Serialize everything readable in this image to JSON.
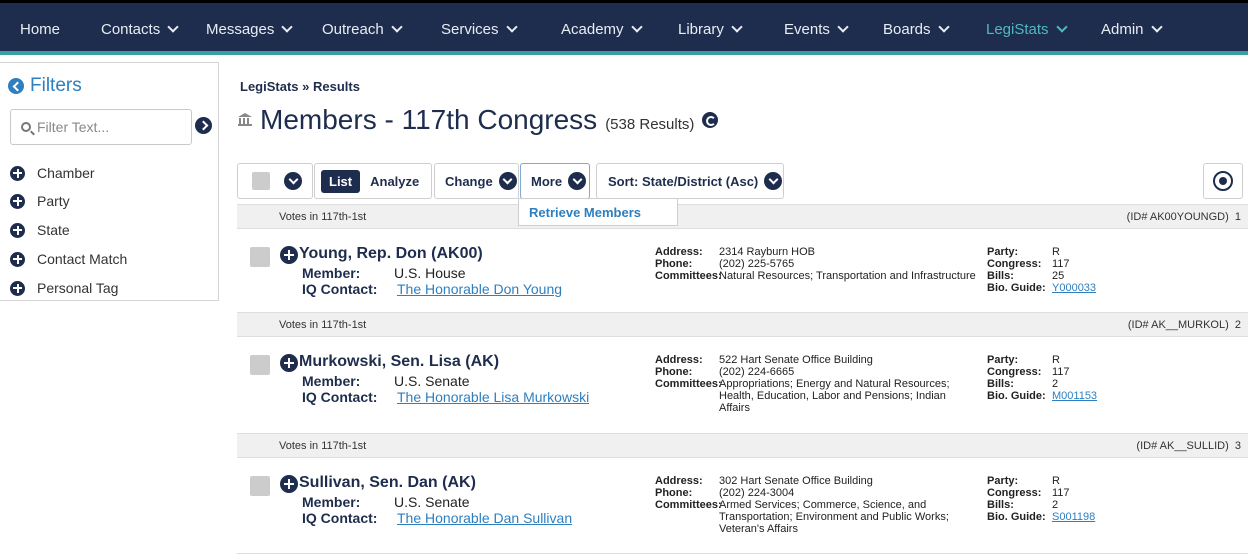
{
  "nav": {
    "items": [
      {
        "label": "Home",
        "dropdown": false
      },
      {
        "label": "Contacts",
        "dropdown": true
      },
      {
        "label": "Messages",
        "dropdown": true
      },
      {
        "label": "Outreach",
        "dropdown": true
      },
      {
        "label": "Services",
        "dropdown": true
      },
      {
        "label": "Academy",
        "dropdown": true
      },
      {
        "label": "Library",
        "dropdown": true
      },
      {
        "label": "Events",
        "dropdown": true
      },
      {
        "label": "Boards",
        "dropdown": true
      },
      {
        "label": "LegiStats",
        "dropdown": true,
        "active": true
      },
      {
        "label": "Admin",
        "dropdown": true
      }
    ]
  },
  "sidebar": {
    "title": "Filters",
    "filter_placeholder": "Filter Text...",
    "items": [
      "Chamber",
      "Party",
      "State",
      "Contact Match",
      "Personal Tag"
    ]
  },
  "breadcrumb": "LegiStats » Results",
  "page": {
    "title": "Members - 117th Congress",
    "count": "(538 Results)"
  },
  "toolbar": {
    "list": "List",
    "analyze": "Analyze",
    "change": "Change",
    "more": "More",
    "sort": "Sort: State/District (Asc)"
  },
  "dropdown": {
    "item": "Retrieve Members"
  },
  "records": [
    {
      "votes": "Votes in 117th-1st",
      "id": "(ID# AK00YOUNGD)",
      "index": "1",
      "name": "Young, Rep. Don (AK00)",
      "member_label": "Member:",
      "member": "U.S. House",
      "contact_label": "IQ Contact:",
      "contact": "The Honorable Don Young",
      "address_label": "Address:",
      "address": "2314 Rayburn HOB",
      "phone_label": "Phone:",
      "phone": "(202) 225-5765",
      "committees_label": "Committees:",
      "committees": "Natural Resources; Transportation and Infrastructure",
      "party_label": "Party:",
      "party": "R",
      "congress_label": "Congress:",
      "congress": "117",
      "bills_label": "Bills:",
      "bills": "25",
      "bio_label": "Bio. Guide:",
      "bio": "Y000033"
    },
    {
      "votes": "Votes in 117th-1st",
      "id": "(ID# AK__MURKOL)",
      "index": "2",
      "name": "Murkowski, Sen. Lisa (AK)",
      "member_label": "Member:",
      "member": "U.S. Senate",
      "contact_label": "IQ Contact:",
      "contact": "The Honorable Lisa Murkowski",
      "address_label": "Address:",
      "address": "522 Hart Senate Office Building",
      "phone_label": "Phone:",
      "phone": "(202) 224-6665",
      "committees_label": "Committees:",
      "committees": "Appropriations; Energy and Natural Resources; Health, Education, Labor and Pensions; Indian Affairs",
      "party_label": "Party:",
      "party": "R",
      "congress_label": "Congress:",
      "congress": "117",
      "bills_label": "Bills:",
      "bills": "2",
      "bio_label": "Bio. Guide:",
      "bio": "M001153"
    },
    {
      "votes": "Votes in 117th-1st",
      "id": "(ID# AK__SULLID)",
      "index": "3",
      "name": "Sullivan, Sen. Dan (AK)",
      "member_label": "Member:",
      "member": "U.S. Senate",
      "contact_label": "IQ Contact:",
      "contact": "The Honorable Dan Sullivan",
      "address_label": "Address:",
      "address": "302 Hart Senate Office Building",
      "phone_label": "Phone:",
      "phone": "(202) 224-3004",
      "committees_label": "Committees:",
      "committees": "Armed Services; Commerce, Science, and Transportation; Environment and Public Works; Veteran's Affairs",
      "party_label": "Party:",
      "party": "R",
      "congress_label": "Congress:",
      "congress": "117",
      "bills_label": "Bills:",
      "bills": "2",
      "bio_label": "Bio. Guide:",
      "bio": "S001198"
    }
  ]
}
